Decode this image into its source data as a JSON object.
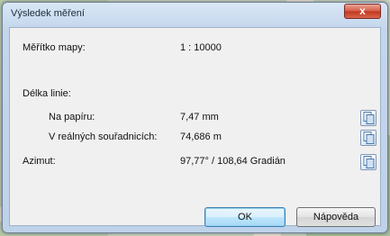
{
  "window": {
    "title": "Výsledek měření",
    "close_glyph": "x"
  },
  "rows": {
    "scale_label": "Měřítko mapy:",
    "scale_value": "1 : 10000",
    "length_label": "Délka linie:",
    "paper_label": "Na papíru:",
    "paper_value": "7,47 mm",
    "real_label": "V reálných souřadnicích:",
    "real_value": "74,686 m",
    "azimuth_label": "Azimut:",
    "azimuth_value": "97,77° / 108,64 Gradián"
  },
  "icons": [
    "copy-icon",
    "copy-icon",
    "copy-icon",
    "close-icon"
  ],
  "buttons": {
    "ok_label": "OK",
    "help_label": "Nápověda"
  },
  "colors": {
    "titlebar": "#c3d6ec",
    "close_button": "#d65b45",
    "client": "#f0f0f0",
    "default_button_border": "#3c7fb1"
  }
}
